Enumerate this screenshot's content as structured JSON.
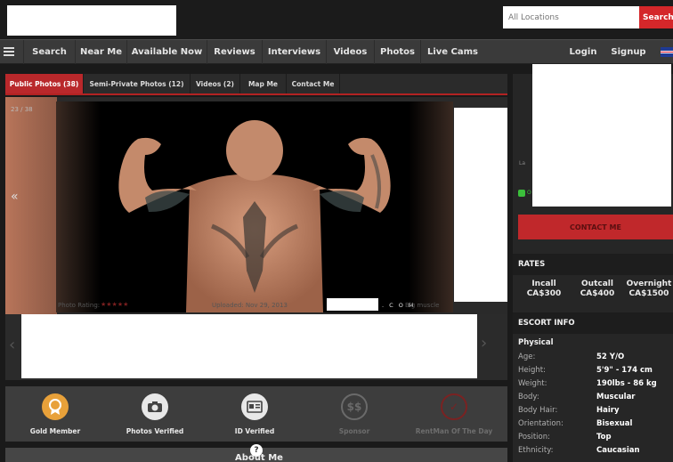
{
  "header": {
    "location_placeholder": "All Locations",
    "search_label": "Search"
  },
  "nav": {
    "items": [
      "Search",
      "Near Me",
      "Available Now",
      "Reviews",
      "Interviews",
      "Videos",
      "Photos",
      "Live Cams"
    ],
    "login": "Login",
    "signup": "Signup"
  },
  "tabs": [
    "Public Photos (38)",
    "Semi-Private Photos (12)",
    "Videos (2)",
    "Map Me",
    "Contact Me"
  ],
  "gallery": {
    "counter": "23 / 38",
    "prev_arrow": "«",
    "rating_label": "Photo Rating:",
    "rating_stars": "★★★★★",
    "uploaded": "Uploaded: Nov 29, 2013",
    "brand_suffix": ". C O M",
    "tag": "Big muscle",
    "thumb_prev": "‹",
    "thumb_next": "›"
  },
  "badges": [
    {
      "label": "Gold Member",
      "icon": "gold-medal-icon",
      "color": "#e8a13a"
    },
    {
      "label": "Photos Verified",
      "icon": "camera-icon",
      "color": "#e8e8e8"
    },
    {
      "label": "ID Verified",
      "icon": "id-card-icon",
      "color": "#e8e8e8"
    },
    {
      "label": "Sponsor",
      "icon": "dollar-icon",
      "color": "#6a6a6a"
    },
    {
      "label": "RentMan Of The Day",
      "icon": "award-icon",
      "color": "#7a2222"
    }
  ],
  "about": {
    "title": "About Me",
    "icon": "question-icon"
  },
  "sidebar": {
    "last_seen": "La",
    "online": "O",
    "contact_button": "CONTACT ME",
    "rates_title": "RATES",
    "rates": [
      {
        "type": "Incall",
        "price": "CA$300"
      },
      {
        "type": "Outcall",
        "price": "CA$400"
      },
      {
        "type": "Overnight",
        "price": "CA$1500"
      }
    ],
    "escort_info_title": "ESCORT INFO",
    "physical_title": "Physical",
    "physical": [
      {
        "label": "Age:",
        "value": "52 Y/O"
      },
      {
        "label": "Height:",
        "value": "5'9\" - 174 cm"
      },
      {
        "label": "Weight:",
        "value": "190lbs - 86 kg"
      },
      {
        "label": "Body:",
        "value": "Muscular"
      },
      {
        "label": "Body Hair:",
        "value": "Hairy"
      },
      {
        "label": "Orientation:",
        "value": "Bisexual"
      },
      {
        "label": "Position:",
        "value": "Top"
      },
      {
        "label": "Ethnicity:",
        "value": "Caucasian"
      }
    ]
  },
  "colors": {
    "accent": "#c0282b",
    "nav_bg": "#3a3a3a",
    "page_bg": "#1a1a1a"
  }
}
